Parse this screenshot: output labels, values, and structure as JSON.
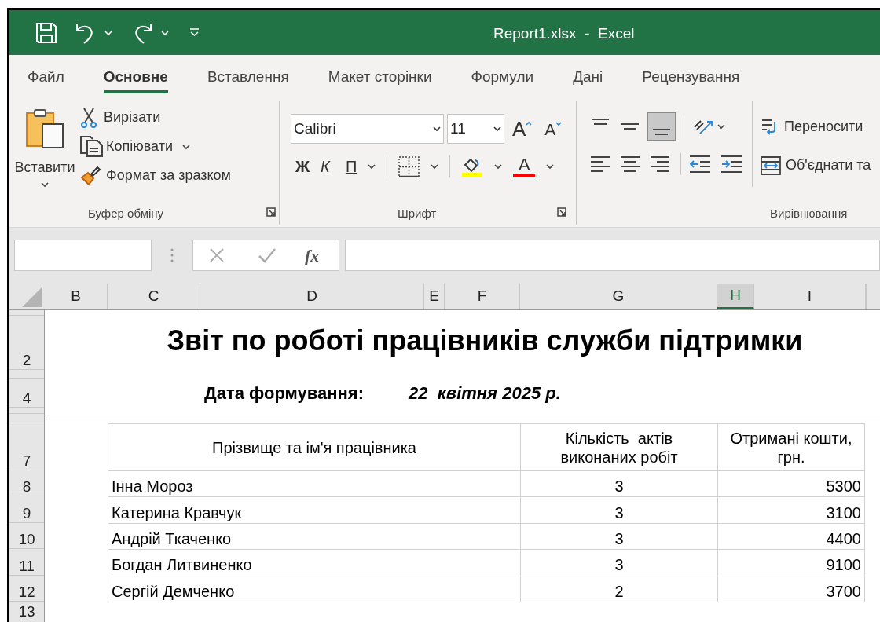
{
  "window": {
    "title": "Report1.xlsx  -  Excel"
  },
  "tabs": [
    {
      "label": "Файл",
      "selected": false
    },
    {
      "label": "Основне",
      "selected": true
    },
    {
      "label": "Вставлення",
      "selected": false
    },
    {
      "label": "Макет сторінки",
      "selected": false
    },
    {
      "label": "Формули",
      "selected": false
    },
    {
      "label": "Дані",
      "selected": false
    },
    {
      "label": "Рецензування",
      "selected": false
    }
  ],
  "clipboard": {
    "paste": "Вставити",
    "cut": "Вирізати",
    "copy": "Копіювати",
    "format_painter": "Формат за зразком",
    "group_label": "Буфер обміну"
  },
  "font": {
    "font_name": "Calibri",
    "font_size": "11",
    "grow": "A",
    "shrink": "A",
    "bold": "Ж",
    "italic": "К",
    "underline": "П",
    "font_color": "A",
    "group_label": "Шрифт"
  },
  "alignment": {
    "vertical": [
      {
        "kind": "top",
        "selected": false
      },
      {
        "kind": "middle",
        "selected": false
      },
      {
        "kind": "bottom",
        "selected": true
      }
    ],
    "horizontal": [
      {
        "kind": "left",
        "selected": false
      },
      {
        "kind": "center",
        "selected": false
      },
      {
        "kind": "right",
        "selected": false
      }
    ],
    "wrap_text": "Переносити",
    "merge": "Об'єднати та",
    "group_label": "Вирівнювання"
  },
  "formula_bar": {
    "function_label": "fx"
  },
  "columns": [
    {
      "label": "B",
      "selected": false
    },
    {
      "label": "C",
      "selected": false
    },
    {
      "label": "D",
      "selected": false
    },
    {
      "label": "E",
      "selected": false
    },
    {
      "label": "F",
      "selected": false
    },
    {
      "label": "G",
      "selected": false
    },
    {
      "label": "H",
      "selected": true
    },
    {
      "label": "I",
      "selected": false
    }
  ],
  "row_numbers": [
    "2",
    "4",
    "7",
    "8",
    "9",
    "10",
    "11",
    "12",
    "13"
  ],
  "report": {
    "title": "Звіт по роботі працівників служби підтримки",
    "date_label": "Дата формування:",
    "date_value": "22  квітня 2025 р.",
    "table": {
      "columns": [
        "Прізвище та ім'я працівника",
        "Кількість  актів виконаних робіт",
        "Отримані кошти, грн."
      ],
      "rows": [
        [
          "Інна Мороз",
          "3",
          "5300"
        ],
        [
          "Катерина Кравчук",
          "3",
          "3100"
        ],
        [
          "Андрій Ткаченко",
          "3",
          "4400"
        ],
        [
          "Богдан Литвиненко",
          "3",
          "9100"
        ],
        [
          "Сергій Демченко",
          "2",
          "3700"
        ]
      ]
    }
  }
}
